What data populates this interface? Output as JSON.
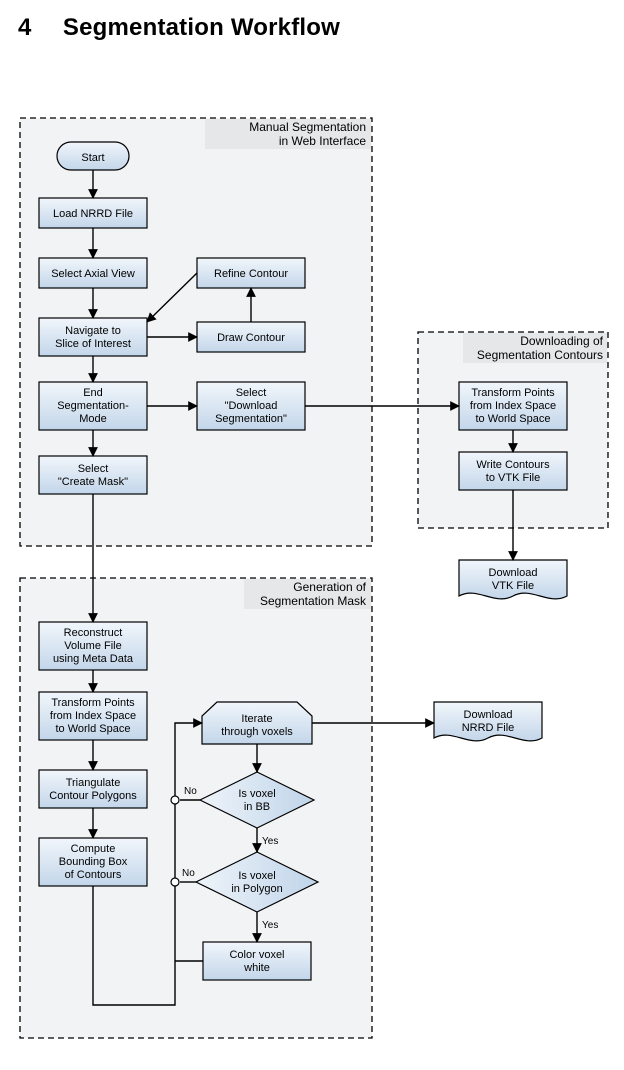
{
  "title_number": "4",
  "title_text": "Segmentation Workflow",
  "groups": {
    "manual": {
      "label_l1": "Manual Segmentation",
      "label_l2": "in Web Interface"
    },
    "download": {
      "label_l1": "Downloading of",
      "label_l2": "Segmentation Contours"
    },
    "mask": {
      "label_l1": "Generation of",
      "label_l2": "Segmentation Mask"
    }
  },
  "nodes": {
    "start": "Start",
    "load_nrrd": "Load NRRD File",
    "select_axial": "Select Axial View",
    "refine_contour": "Refine Contour",
    "navigate_slice_l1": "Navigate to",
    "navigate_slice_l2": "Slice of Interest",
    "draw_contour": "Draw Contour",
    "end_seg_l1": "End",
    "end_seg_l2": "Segmentation-",
    "end_seg_l3": "Mode",
    "select_download_l1": "Select",
    "select_download_l2": "\"Download",
    "select_download_l3": "Segmentation\"",
    "select_create_l1": "Select",
    "select_create_l2": "\"Create Mask\"",
    "transform1_l1": "Transform Points",
    "transform1_l2": "from Index Space",
    "transform1_l3": "to World Space",
    "write_contours_l1": "Write Contours",
    "write_contours_l2": "to VTK File",
    "download_vtk_l1": "Download",
    "download_vtk_l2": "VTK File",
    "reconstruct_l1": "Reconstruct",
    "reconstruct_l2": "Volume File",
    "reconstruct_l3": "using Meta Data",
    "transform2_l1": "Transform Points",
    "transform2_l2": "from Index Space",
    "transform2_l3": "to World Space",
    "triangulate_l1": "Triangulate",
    "triangulate_l2": "Contour Polygons",
    "bbox_l1": "Compute",
    "bbox_l2": "Bounding Box",
    "bbox_l3": "of Contours",
    "iterate_l1": "Iterate",
    "iterate_l2": "through voxels",
    "voxel_bb_l1": "Is voxel",
    "voxel_bb_l2": "in BB",
    "voxel_poly_l1": "Is voxel",
    "voxel_poly_l2": "in Polygon",
    "color_l1": "Color voxel",
    "color_l2": "white",
    "download_nrrd_l1": "Download",
    "download_nrrd_l2": "NRRD File"
  },
  "edges": {
    "no": "No",
    "yes": "Yes"
  },
  "chart_data": {
    "type": "flowchart",
    "groups": [
      {
        "id": "manual",
        "label": "Manual Segmentation in Web Interface"
      },
      {
        "id": "download",
        "label": "Downloading of Segmentation Contours"
      },
      {
        "id": "mask",
        "label": "Generation of Segmentation Mask"
      }
    ],
    "nodes": [
      {
        "id": "start",
        "label": "Start",
        "type": "terminator",
        "group": "manual"
      },
      {
        "id": "load_nrrd",
        "label": "Load NRRD File",
        "type": "process",
        "group": "manual"
      },
      {
        "id": "select_axial",
        "label": "Select Axial View",
        "type": "process",
        "group": "manual"
      },
      {
        "id": "refine_contour",
        "label": "Refine Contour",
        "type": "process",
        "group": "manual"
      },
      {
        "id": "navigate_slice",
        "label": "Navigate to Slice of Interest",
        "type": "process",
        "group": "manual"
      },
      {
        "id": "draw_contour",
        "label": "Draw Contour",
        "type": "process",
        "group": "manual"
      },
      {
        "id": "end_seg",
        "label": "End Segmentation-Mode",
        "type": "process",
        "group": "manual"
      },
      {
        "id": "select_download",
        "label": "Select \"Download Segmentation\"",
        "type": "process",
        "group": "manual"
      },
      {
        "id": "select_create",
        "label": "Select \"Create Mask\"",
        "type": "process",
        "group": "manual"
      },
      {
        "id": "transform1",
        "label": "Transform Points from Index Space to World Space",
        "type": "process",
        "group": "download"
      },
      {
        "id": "write_contours",
        "label": "Write Contours to VTK File",
        "type": "process",
        "group": "download"
      },
      {
        "id": "download_vtk",
        "label": "Download VTK File",
        "type": "document",
        "group": null
      },
      {
        "id": "reconstruct",
        "label": "Reconstruct Volume File using Meta Data",
        "type": "process",
        "group": "mask"
      },
      {
        "id": "transform2",
        "label": "Transform Points from Index Space to World Space",
        "type": "process",
        "group": "mask"
      },
      {
        "id": "triangulate",
        "label": "Triangulate Contour Polygons",
        "type": "process",
        "group": "mask"
      },
      {
        "id": "bbox",
        "label": "Compute Bounding Box of Contours",
        "type": "process",
        "group": "mask"
      },
      {
        "id": "iterate",
        "label": "Iterate through voxels",
        "type": "loop",
        "group": "mask"
      },
      {
        "id": "voxel_bb",
        "label": "Is voxel in BB",
        "type": "decision",
        "group": "mask"
      },
      {
        "id": "voxel_poly",
        "label": "Is voxel in Polygon",
        "type": "decision",
        "group": "mask"
      },
      {
        "id": "color",
        "label": "Color voxel white",
        "type": "process",
        "group": "mask"
      },
      {
        "id": "download_nrrd",
        "label": "Download NRRD File",
        "type": "document",
        "group": null
      }
    ],
    "edges": [
      {
        "from": "start",
        "to": "load_nrrd"
      },
      {
        "from": "load_nrrd",
        "to": "select_axial"
      },
      {
        "from": "select_axial",
        "to": "navigate_slice"
      },
      {
        "from": "navigate_slice",
        "to": "draw_contour"
      },
      {
        "from": "draw_contour",
        "to": "refine_contour"
      },
      {
        "from": "refine_contour",
        "to": "navigate_slice"
      },
      {
        "from": "navigate_slice",
        "to": "end_seg"
      },
      {
        "from": "end_seg",
        "to": "select_download"
      },
      {
        "from": "end_seg",
        "to": "select_create"
      },
      {
        "from": "select_download",
        "to": "transform1"
      },
      {
        "from": "transform1",
        "to": "write_contours"
      },
      {
        "from": "write_contours",
        "to": "download_vtk"
      },
      {
        "from": "select_create",
        "to": "reconstruct"
      },
      {
        "from": "reconstruct",
        "to": "transform2"
      },
      {
        "from": "transform2",
        "to": "triangulate"
      },
      {
        "from": "triangulate",
        "to": "bbox"
      },
      {
        "from": "bbox",
        "to": "iterate"
      },
      {
        "from": "iterate",
        "to": "voxel_bb"
      },
      {
        "from": "voxel_bb",
        "to": "iterate",
        "label": "No"
      },
      {
        "from": "voxel_bb",
        "to": "voxel_poly",
        "label": "Yes"
      },
      {
        "from": "voxel_poly",
        "to": "iterate",
        "label": "No"
      },
      {
        "from": "voxel_poly",
        "to": "color",
        "label": "Yes"
      },
      {
        "from": "color",
        "to": "iterate"
      },
      {
        "from": "iterate",
        "to": "download_nrrd"
      }
    ]
  }
}
